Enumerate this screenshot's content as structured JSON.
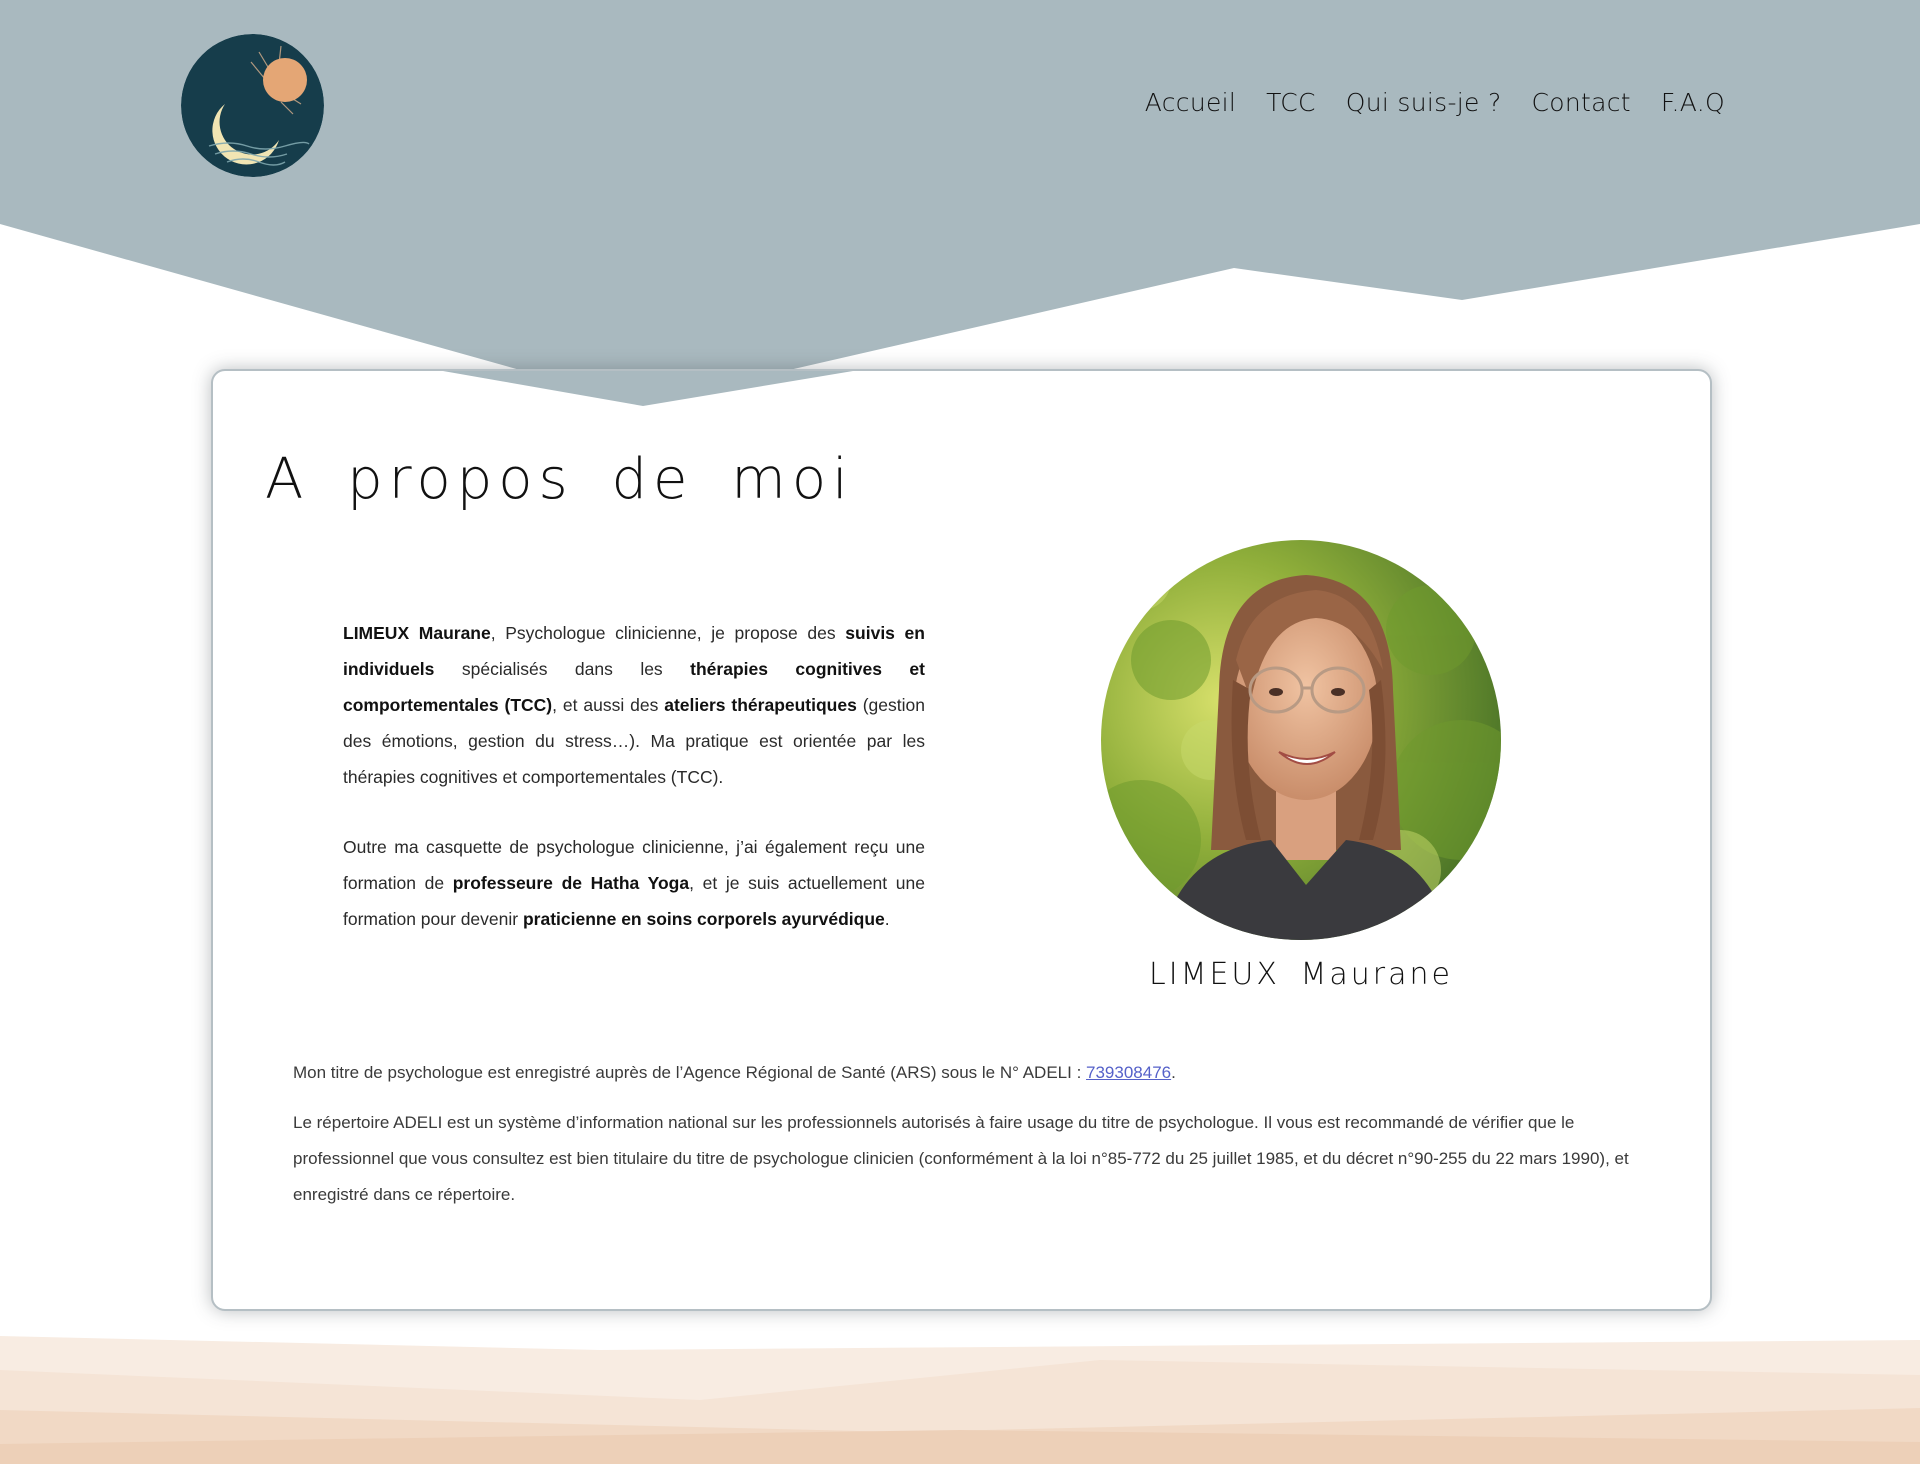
{
  "brand": {
    "logo": "moon-sun-logo"
  },
  "nav": {
    "items": [
      {
        "label": "Accueil"
      },
      {
        "label": "TCC"
      },
      {
        "label": "Qui suis-je ?"
      },
      {
        "label": "Contact"
      },
      {
        "label": "F.A.Q"
      }
    ]
  },
  "colors": {
    "header_bg": "#a9b9bf",
    "logo_bg": "#163d4b",
    "moon": "#f1e5b3",
    "sun": "#e4a675",
    "link": "#5561c9",
    "footer_wave": "#f3ddc9"
  },
  "main": {
    "title": "A propos de moi",
    "intro": {
      "p1": [
        {
          "text": "LIMEUX Maurane",
          "bold": true
        },
        {
          "text": ", Psychologue clinicienne, je propose des ",
          "bold": false
        },
        {
          "text": "suivis en individuels",
          "bold": true
        },
        {
          "text": " spécialisés dans les ",
          "bold": false
        },
        {
          "text": "thérapies cognitives et comportementales (TCC)",
          "bold": true
        },
        {
          "text": ", et aussi des ",
          "bold": false
        },
        {
          "text": "ateliers thérapeutiques",
          "bold": true
        },
        {
          "text": " (gestion des émotions, gestion du stress…). Ma pratique est orientée par les thérapies cognitives et comportementales (TCC).",
          "bold": false
        }
      ],
      "p2": [
        {
          "text": "Outre ma casquette de psychologue clinicienne, j’ai également reçu une formation de ",
          "bold": false
        },
        {
          "text": "professeure de Hatha Yoga",
          "bold": true
        },
        {
          "text": ", et je suis actuellement une formation pour devenir ",
          "bold": false
        },
        {
          "text": "praticienne en soins corporels ayurvédique",
          "bold": true
        },
        {
          "text": ".",
          "bold": false
        }
      ]
    },
    "portrait": {
      "name": "LIMEUX Maurane"
    },
    "adeli": {
      "line_prefix": "Mon titre de psychologue est enregistré auprès de l’Agence Régional de Santé (ARS) sous le N° ADELI : ",
      "number": "739308476",
      "line_suffix": ".",
      "info": "Le répertoire ADELI est un système d’information national sur les professionnels autorisés à faire usage du titre de psychologue. Il vous est recommandé de vérifier que le professionnel que vous consultez est bien titulaire du titre de psychologue clinicien (conformément à la loi n°85-772 du 25 juillet 1985, et du décret n°90-255 du 22 mars 1990), et enregistré dans ce répertoire."
    }
  }
}
